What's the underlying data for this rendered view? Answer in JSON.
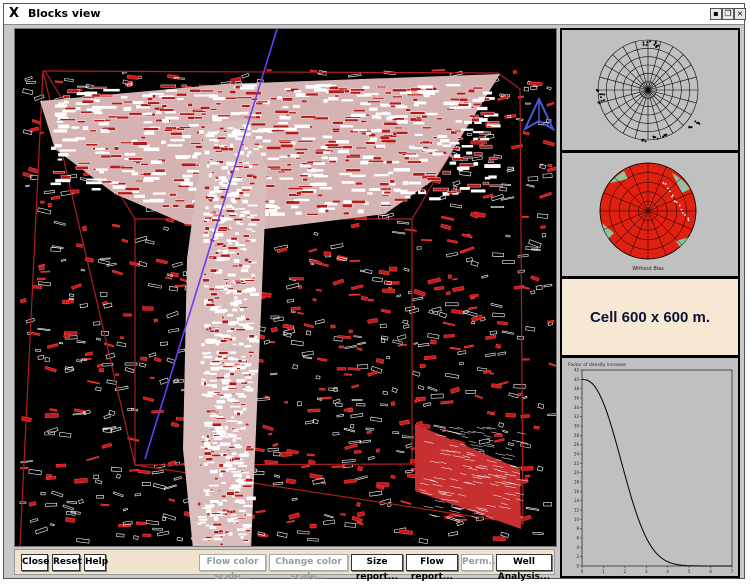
{
  "window": {
    "title": "Blocks view",
    "app_icon": "x-icon",
    "controls": [
      "minimize-icon",
      "restore-icon",
      "close-icon"
    ]
  },
  "viewport": {
    "background": "#000000",
    "bounding_box_color": "#b01e1e",
    "fracture_color": "#ffffff",
    "fracture_edge_color": "#d42020",
    "well_path_color": "#6b3cf0",
    "north_arrow_color": "#4a58d8",
    "icon": "north-arrow-icon"
  },
  "stereonet_top": {
    "background": "#c0c0c0"
  },
  "stereonet_density": {
    "fill_color": "#e02010",
    "highlight_color": "#7fe8c0",
    "caption": "Without Bias"
  },
  "cell_panel": {
    "label": "Cell 600 x 600 m."
  },
  "curve_panel": {
    "title": "Factor of density increase",
    "x_ticks": [
      "0",
      "1",
      "2",
      "3",
      "4",
      "5",
      "6",
      "7"
    ],
    "y_ticks": [
      "0",
      "2",
      "4",
      "6",
      "8",
      "10",
      "12",
      "14",
      "16",
      "18",
      "20",
      "22",
      "24",
      "26",
      "28",
      "30",
      "32",
      "34",
      "36",
      "38",
      "40",
      "42"
    ]
  },
  "buttons": {
    "close": "Close",
    "reset": "Reset",
    "help": "Help",
    "flow_color_scale": "Flow color scale...",
    "change_color_scale": "Change color scale...",
    "size_report": "Size report...",
    "flow_report": "Flow report...",
    "perm": "Perm...",
    "well_analysis": "Well Analysis..."
  }
}
